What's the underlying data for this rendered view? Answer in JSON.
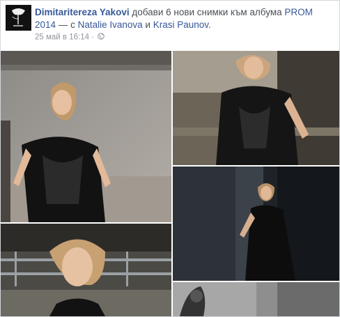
{
  "post": {
    "actor": "Dimitaritereza Yakovi",
    "action": "добави 6 нови снимки към албума",
    "album": "PROM 2014",
    "with_prefix": "— с",
    "tag1": "Natalie Ivanova",
    "conj": "и",
    "tag2": "Krasi Paunov",
    "end": ".",
    "timestamp": "25 май в 16:14",
    "separator": "·",
    "privacy_icon": "globe-icon"
  },
  "photos": [
    {
      "name": "photo-1",
      "subject": "woman in black lace dress standing by fence"
    },
    {
      "name": "photo-2",
      "subject": "woman in black lace dress, close crop"
    },
    {
      "name": "photo-3",
      "subject": "woman in black dress by dark wall"
    },
    {
      "name": "photo-4",
      "subject": "woman portrait with fence background"
    },
    {
      "name": "photo-5",
      "subject": "grayscale partial photo"
    }
  ],
  "colors": {
    "link": "#365899",
    "text": "#4b4f56",
    "meta": "#90949c"
  }
}
